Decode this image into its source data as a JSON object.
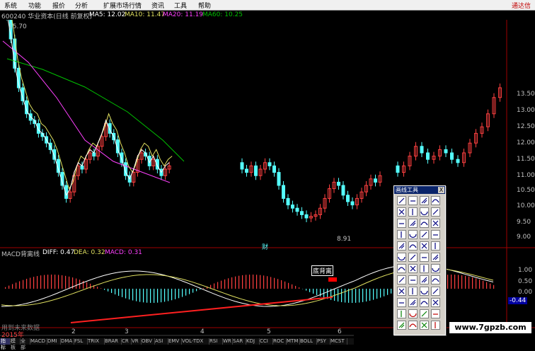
{
  "menu": {
    "items": [
      "系统",
      "功能",
      "报价",
      "分析",
      "扩展市场行情",
      "资讯",
      "工具",
      "帮助"
    ],
    "brand": "通达信"
  },
  "header": {
    "code_name": "600240 华业资本(日线 前复权)",
    "ma5": "MA5: 12.02",
    "ma10": "MA10: 11.47",
    "ma20": "MA20: 11.19",
    "ma60": "MA60: 10.25"
  },
  "price_axis": [
    "13.50",
    "13.00",
    "12.50",
    "12.00",
    "11.50",
    "11.00",
    "10.50",
    "10.00",
    "9.50",
    "9.00"
  ],
  "annotations": {
    "high_label": "15.70",
    "low_label": "8.91",
    "cai_label": "财",
    "bottom_divergence": "底背离"
  },
  "indicator": {
    "name": "MACD背离线",
    "diff": "DIFF: 0.47",
    "dea": "DEA: 0.32",
    "macd": "MACD: 0.31",
    "axis": [
      "1.00",
      "0.50",
      "0.00",
      "-0.44"
    ]
  },
  "x_axis": {
    "year": "2015年",
    "months": [
      "2",
      "3",
      "4",
      "5",
      "6"
    ],
    "footer": "用到未来数据"
  },
  "tabs": [
    "指标",
    "模板",
    "全部",
    "MACD",
    "DMI",
    "DMA",
    "FSL",
    "TRIX",
    "BRAR",
    "CR",
    "VR",
    "OBV",
    "ASI",
    "EMV",
    "VOL-TDX",
    "RSI",
    "WR",
    "SAR",
    "KDJ",
    "CCI",
    "ROC",
    "MTM",
    "BOLL",
    "PSY",
    "MCST"
  ],
  "toolbox": {
    "title": "画线工具",
    "close": "X"
  },
  "watermark": "www.7gpzb.com",
  "colors": {
    "up": "#ff4040",
    "down": "#54ffff",
    "ma5": "#ffffff",
    "ma10": "#e0e060",
    "ma20": "#ff40ff",
    "ma60": "#00c000",
    "axis": "#a00000"
  }
}
